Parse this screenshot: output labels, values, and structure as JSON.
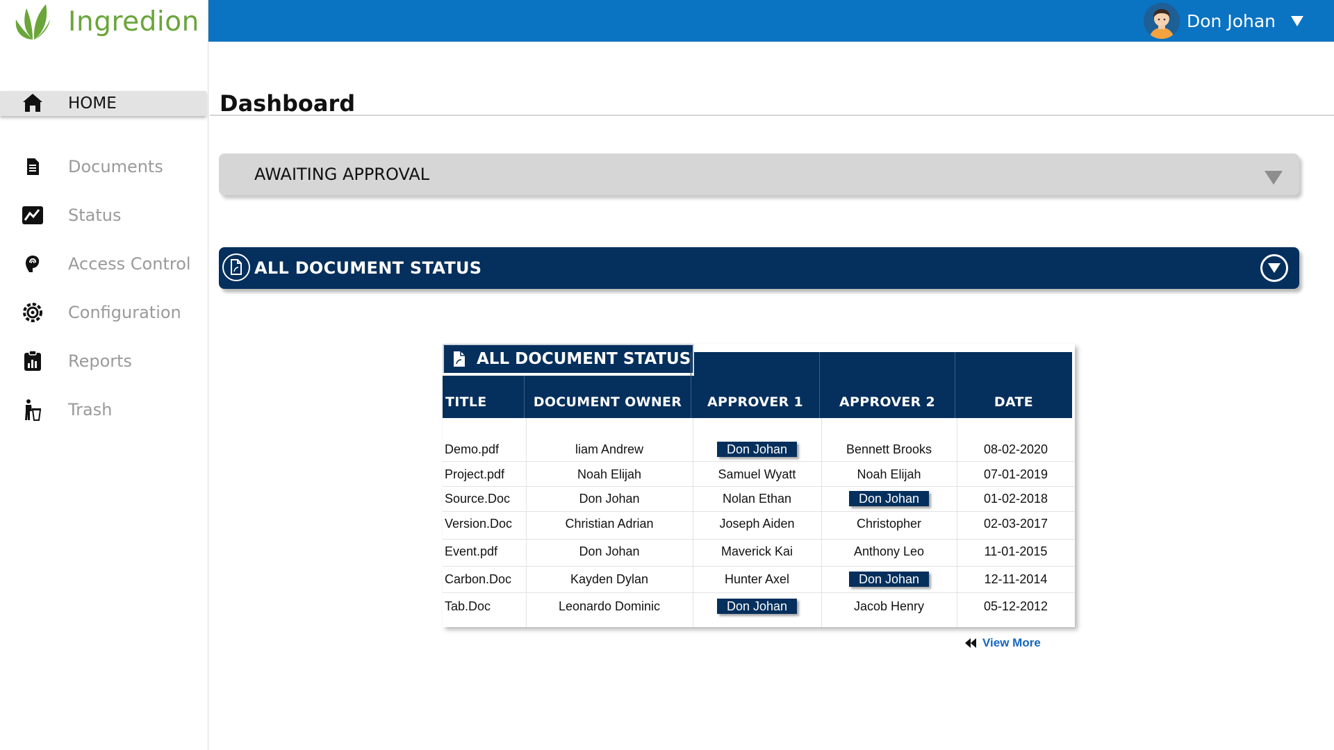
{
  "brand": {
    "name": "Ingredion",
    "color": "#6aa53a"
  },
  "header": {
    "user_name": "Don Johan",
    "bar_color": "#0a73c2"
  },
  "sidebar": {
    "items": [
      {
        "label": "HOME",
        "icon": "home-icon"
      },
      {
        "label": "Documents",
        "icon": "document-icon"
      },
      {
        "label": "Status",
        "icon": "chart-line-icon"
      },
      {
        "label": "Access Control",
        "icon": "fingerprint-icon"
      },
      {
        "label": "Configuration",
        "icon": "gear-icon"
      },
      {
        "label": "Reports",
        "icon": "clipboard-chart-icon"
      },
      {
        "label": "Trash",
        "icon": "trash-person-icon"
      }
    ]
  },
  "main": {
    "title": "Dashboard",
    "awaiting_label": "AWAITING APPROVAL",
    "status_label": "ALL DOCUMENT STATUS",
    "accent_color": "#052f5c"
  },
  "table": {
    "tab_label": "ALL DOCUMENT STATUS",
    "headers": [
      "TITLE",
      "DOCUMENT OWNER",
      "APPROVER 1",
      "APPROVER 2",
      "DATE"
    ],
    "rows": [
      {
        "title": "Demo.pdf",
        "owner": "liam Andrew",
        "approver1": "Don Johan",
        "approver2": "Bennett Brooks",
        "date": "08-02-2020"
      },
      {
        "title": "Project.pdf",
        "owner": "Noah Elijah",
        "approver1": "Samuel Wyatt",
        "approver2": "Noah Elijah",
        "date": "07-01-2019"
      },
      {
        "title": "Source.Doc",
        "owner": "Don Johan",
        "approver1": "Nolan Ethan",
        "approver2": "Don Johan",
        "date": "01-02-2018"
      },
      {
        "title": "Version.Doc",
        "owner": "Christian Adrian",
        "approver1": "Joseph Aiden",
        "approver2": "Christopher",
        "date": "02-03-2017"
      },
      {
        "title": "Event.pdf",
        "owner": "Don Johan",
        "approver1": "Maverick Kai",
        "approver2": "Anthony Leo",
        "date": "11-01-2015"
      },
      {
        "title": "Carbon.Doc",
        "owner": "Kayden Dylan",
        "approver1": "Hunter Axel",
        "approver2": "Don Johan",
        "date": "12-11-2014"
      },
      {
        "title": "Tab.Doc",
        "owner": "Leonardo Dominic",
        "approver1": "Don Johan",
        "approver2": "Jacob Henry",
        "date": "05-12-2012"
      }
    ],
    "view_more": "View More"
  }
}
